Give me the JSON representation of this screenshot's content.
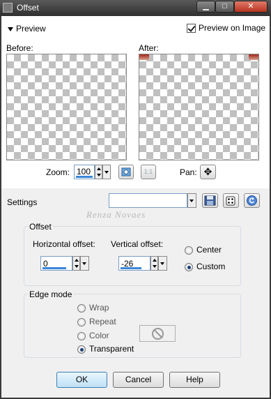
{
  "window": {
    "title": "Offset",
    "min_icon": "▁",
    "max_icon": "□",
    "close_icon": "✕"
  },
  "preview": {
    "toggle_label": "Preview",
    "preview_on_image_label": "Preview on Image",
    "preview_on_image_checked": true,
    "before_label": "Before:",
    "after_label": "After:"
  },
  "zoom": {
    "label": "Zoom:",
    "value": "100",
    "one_to_one_label": "1:1",
    "pan_label": "Pan:",
    "pan_icon": "✥"
  },
  "settings": {
    "label": "Settings",
    "preset_value": "",
    "watermark": "Renza Novaes"
  },
  "offset": {
    "group_title": "Offset",
    "horizontal_label": "Horizontal offset:",
    "horizontal_value": "0",
    "vertical_label": "Vertical offset:",
    "vertical_value": "-26",
    "center_label": "Center",
    "custom_label": "Custom",
    "selected": "custom"
  },
  "edge_mode": {
    "group_title": "Edge mode",
    "options": [
      "Wrap",
      "Repeat",
      "Color",
      "Transparent"
    ],
    "selected": "Transparent"
  },
  "buttons": {
    "ok": "OK",
    "cancel": "Cancel",
    "help": "Help"
  },
  "colors": {
    "accent": "#3a86d8",
    "after_edge": "#a0281a",
    "ok_highlight": "#bfe1f6"
  },
  "icons": [
    "app-icon",
    "minimize-icon",
    "maximize-icon",
    "close-icon",
    "zoom-fit-icon",
    "pan-icon",
    "save-preset-icon",
    "randomize-icon",
    "reset-icon",
    "no-color-icon"
  ]
}
